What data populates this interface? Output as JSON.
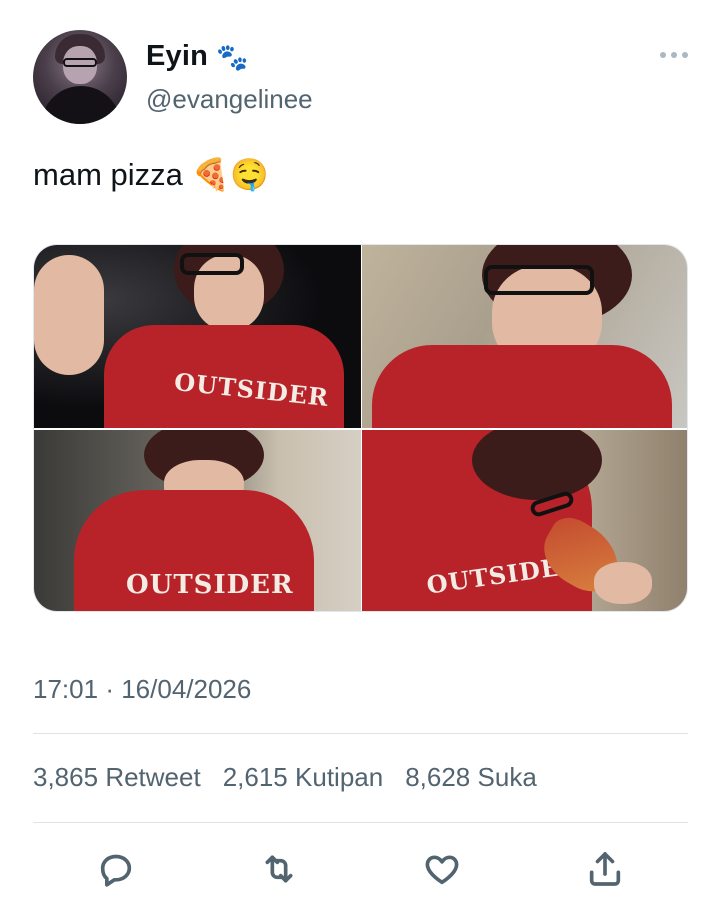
{
  "author": {
    "name": "Eyin",
    "name_emoji": "🐾",
    "handle": "@evangelinee"
  },
  "tweet": {
    "text": "mam pizza 🍕🤤",
    "photos": [
      {
        "print": "OUTSIDER"
      },
      {
        "print": ""
      },
      {
        "print": "OUTSIDER"
      },
      {
        "print": "OUTSIDER"
      }
    ]
  },
  "meta": {
    "time": "17:01",
    "separator": "·",
    "date": "16/04/2026"
  },
  "stats": {
    "retweets": "3,865",
    "retweets_label": "Retweet",
    "quotes": "2,615",
    "quotes_label": "Kutipan",
    "likes": "8,628",
    "likes_label": "Suka"
  },
  "actions": {
    "icons": [
      "reply-icon",
      "retweet-icon",
      "like-icon",
      "share-icon"
    ]
  },
  "colors": {
    "text_primary": "#0f1419",
    "text_secondary": "#536471",
    "divider": "#dde3e7",
    "shirt_red": "#b8232a"
  }
}
